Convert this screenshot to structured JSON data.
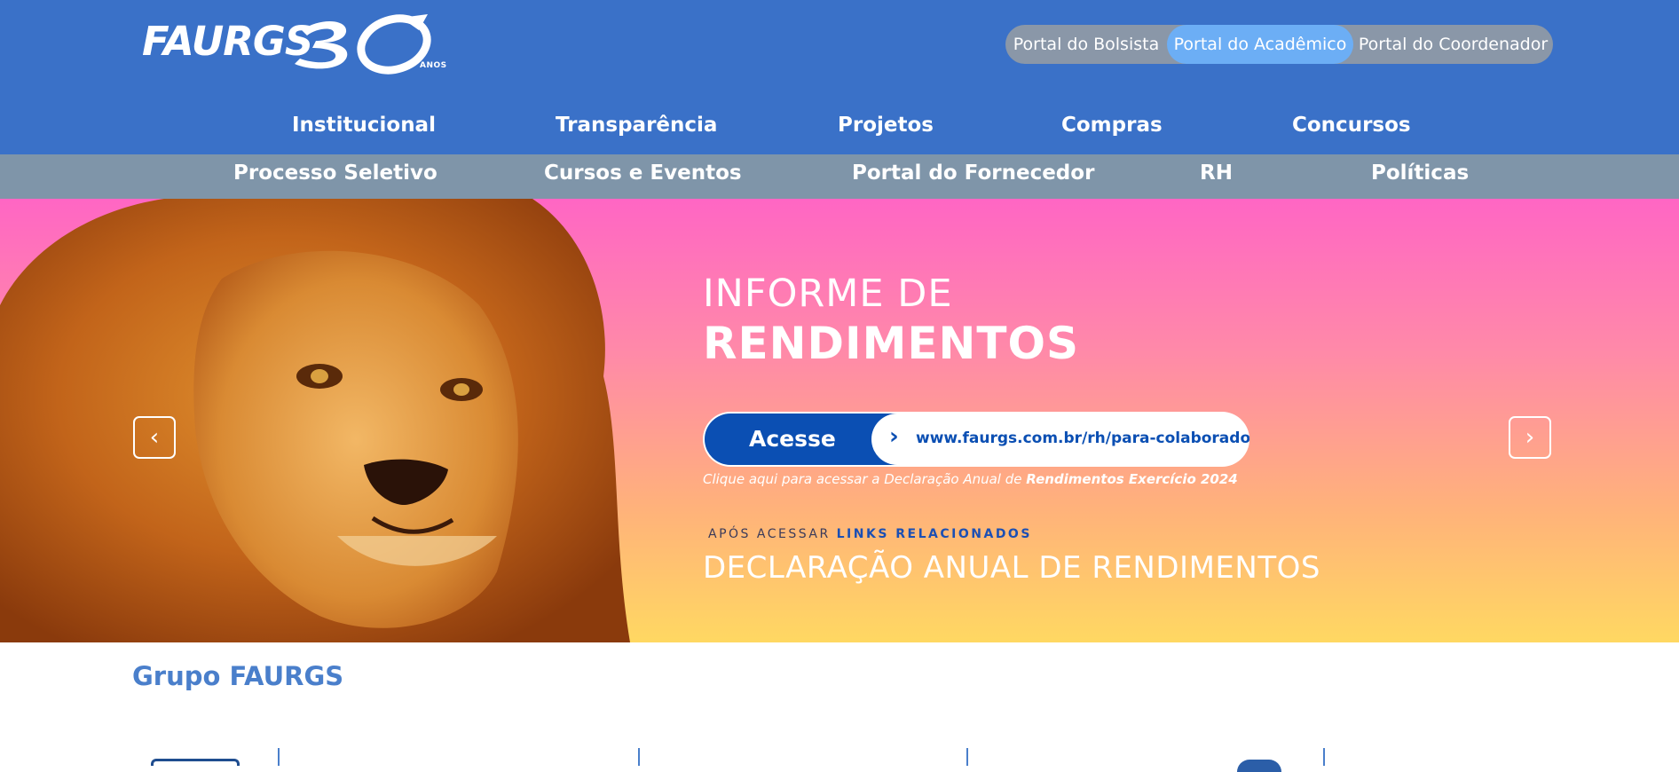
{
  "header": {
    "logo_text": "FAURGS",
    "logo_number": "30",
    "logo_anos": "ANOS",
    "portals": [
      {
        "label": "Portal do Bolsista"
      },
      {
        "label": "Portal do Acadêmico"
      },
      {
        "label": "Portal do Coordenador"
      }
    ],
    "nav_primary": [
      {
        "label": "Institucional"
      },
      {
        "label": "Transparência"
      },
      {
        "label": "Projetos"
      },
      {
        "label": "Compras"
      },
      {
        "label": "Concursos"
      }
    ],
    "nav_secondary": [
      {
        "label": "Processo Seletivo"
      },
      {
        "label": "Cursos e Eventos"
      },
      {
        "label": "Portal do Fornecedor"
      },
      {
        "label": "RH"
      },
      {
        "label": "Políticas"
      }
    ]
  },
  "banner": {
    "title_line1": "INFORME DE",
    "title_line2": "RENDIMENTOS",
    "access_label": "Acesse",
    "access_url": "www.faurgs.com.br/rh/para-colaboradores/",
    "note_prefix": "Clique aqui para acessar a Declaração Anual de ",
    "note_bold": "Rendimentos Exercício 2024",
    "small_prefix": "APÓS ACESSAR ",
    "small_bold": "LINKS RELACIONADOS",
    "big_text": "DECLARAÇÃO ANUAL DE RENDIMENTOS",
    "prev_arrow": "‹",
    "next_arrow": "›"
  },
  "section": {
    "title": "Grupo FAURGS"
  },
  "colors": {
    "header_blue": "#3a71c8",
    "subnav_gray": "#7f95a9",
    "portal_active": "#6caef5",
    "access_blue": "#0b4fb3",
    "section_title": "#4a7fcb"
  }
}
